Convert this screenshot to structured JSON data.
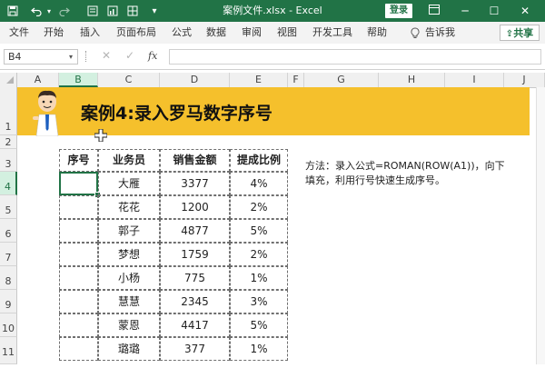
{
  "window": {
    "title": "案例文件.xlsx  -  Excel",
    "login_label": "登录",
    "share_label": "共享",
    "tellme_label": "告诉我"
  },
  "ribbon": {
    "tabs": [
      "文件",
      "开始",
      "插入",
      "页面布局",
      "公式",
      "数据",
      "审阅",
      "视图",
      "开发工具",
      "帮助"
    ]
  },
  "formula_bar": {
    "name_box": "B4",
    "fx_label": "fx",
    "value": ""
  },
  "grid": {
    "columns": [
      "A",
      "B",
      "C",
      "D",
      "E",
      "F",
      "G",
      "H",
      "I",
      "J"
    ],
    "rows": [
      "1",
      "2",
      "3",
      "4",
      "5",
      "6",
      "7",
      "8",
      "9",
      "10",
      "11"
    ],
    "selected_cell": "B4"
  },
  "banner": {
    "title": "案例4:录入罗马数字序号"
  },
  "table": {
    "headers": [
      "序号",
      "业务员",
      "销售金额",
      "提成比例"
    ],
    "rows": [
      [
        "",
        "大雁",
        "3377",
        "4%"
      ],
      [
        "",
        "花花",
        "1200",
        "2%"
      ],
      [
        "",
        "郭子",
        "4877",
        "5%"
      ],
      [
        "",
        "梦想",
        "1759",
        "2%"
      ],
      [
        "",
        "小杨",
        "775",
        "1%"
      ],
      [
        "",
        "慧慧",
        "2345",
        "3%"
      ],
      [
        "",
        "蒙恩",
        "4417",
        "5%"
      ],
      [
        "",
        "璐璐",
        "377",
        "1%"
      ]
    ]
  },
  "note": "方法：录入公式=ROMAN(ROW(A1))，向下填充，利用行号快速生成序号。",
  "colors": {
    "excel_green": "#217346",
    "banner": "#f5c02c"
  }
}
